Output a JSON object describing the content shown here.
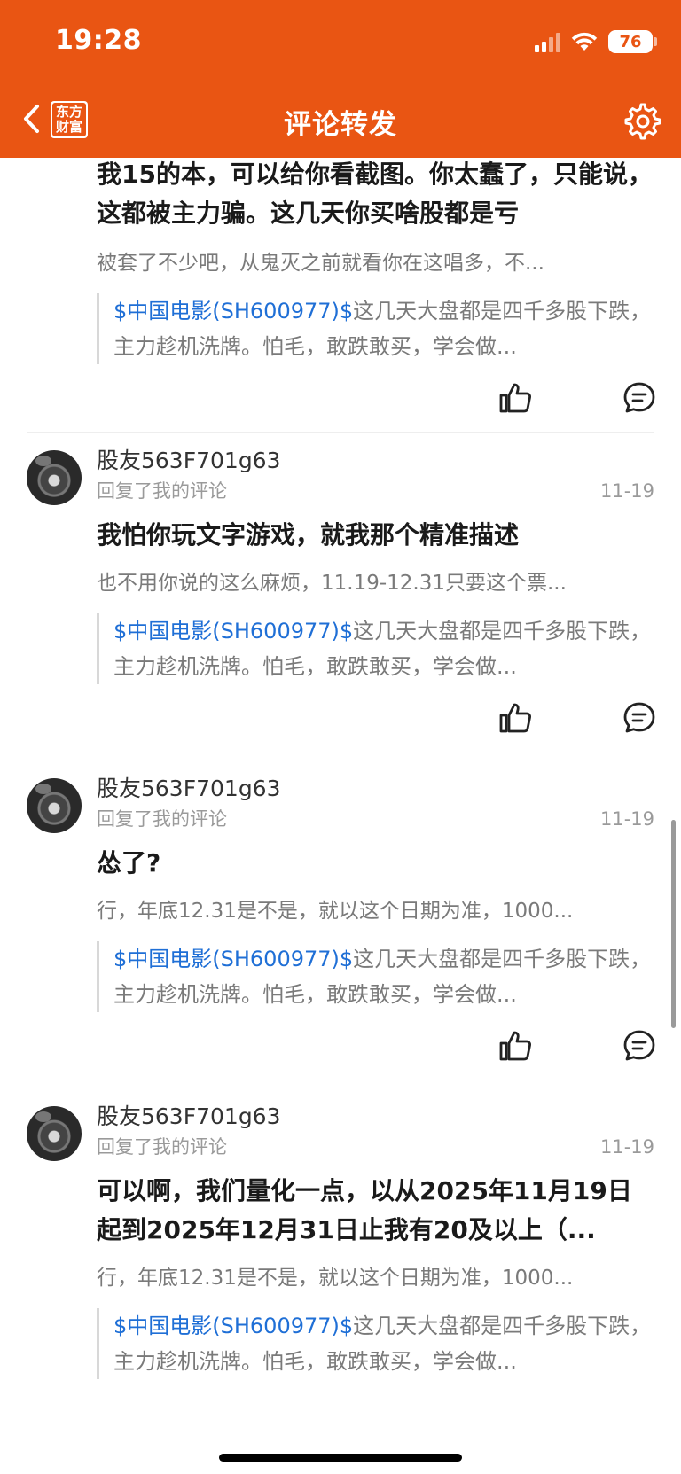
{
  "status_bar": {
    "time": "19:28",
    "battery": "76"
  },
  "nav": {
    "title": "评论转发",
    "logo_line1": "东方",
    "logo_line2": "财富"
  },
  "colors": {
    "header_bg": "#E95513",
    "stock_link": "#1f6fd6"
  },
  "items": [
    {
      "comment": "我15的本，可以给你看截图。你太蠢了，只能说，这都被主力骗。这几天你买啥股都是亏",
      "reply": "被套了不少吧，从鬼灭之前就看你在这唱多，不...",
      "quote_stock": "$中国电影(SH600977)$",
      "quote_text": "这几天大盘都是四千多股下跌，主力趁机洗牌。怕毛，敢跌敢买，学会做..."
    },
    {
      "user": "股友563F701g63",
      "action": "回复了我的评论",
      "date": "11-19",
      "comment": "我怕你玩文字游戏，就我那个精准描述",
      "reply": "也不用你说的这么麻烦，11.19-12.31只要这个票...",
      "quote_stock": "$中国电影(SH600977)$",
      "quote_text": "这几天大盘都是四千多股下跌，主力趁机洗牌。怕毛，敢跌敢买，学会做..."
    },
    {
      "user": "股友563F701g63",
      "action": "回复了我的评论",
      "date": "11-19",
      "comment": "怂了?",
      "reply": "行，年底12.31是不是，就以这个日期为准，1000...",
      "quote_stock": "$中国电影(SH600977)$",
      "quote_text": "这几天大盘都是四千多股下跌，主力趁机洗牌。怕毛，敢跌敢买，学会做..."
    },
    {
      "user": "股友563F701g63",
      "action": "回复了我的评论",
      "date": "11-19",
      "comment": "可以啊，我们量化一点，以从2025年11月19日起到2025年12月31日止我有20及以上（...",
      "reply": "行，年底12.31是不是，就以这个日期为准，1000...",
      "quote_stock": "$中国电影(SH600977)$",
      "quote_text": "这几天大盘都是四千多股下跌，主力趁机洗牌。怕毛，敢跌敢买，学会做..."
    }
  ]
}
